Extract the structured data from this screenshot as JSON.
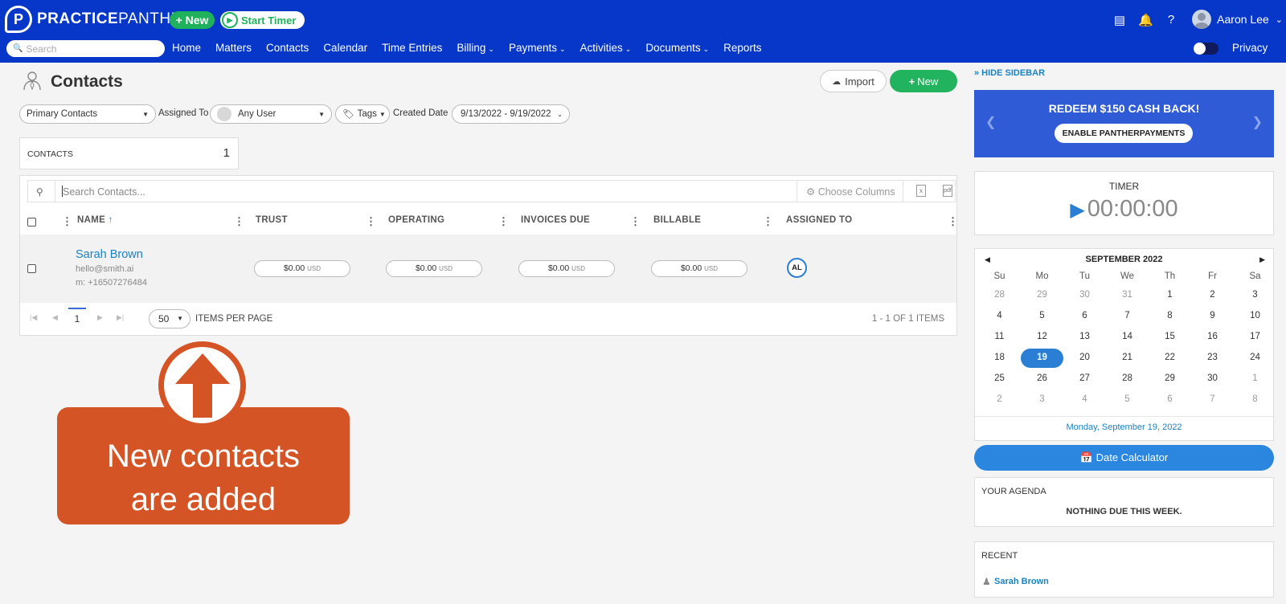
{
  "header": {
    "logo_bold": "PRACTICE",
    "logo_light": "PANTHER",
    "logo_reg": "®",
    "new_label": "+ New",
    "timer_label": "Start Timer",
    "user_name": "Aaron Lee",
    "search_placeholder": "Search",
    "privacy_label": "Privacy",
    "nav": [
      {
        "label": "Home",
        "dropdown": false
      },
      {
        "label": "Matters",
        "dropdown": false
      },
      {
        "label": "Contacts",
        "dropdown": false
      },
      {
        "label": "Calendar",
        "dropdown": false
      },
      {
        "label": "Time Entries",
        "dropdown": false
      },
      {
        "label": "Billing",
        "dropdown": true
      },
      {
        "label": "Payments",
        "dropdown": true
      },
      {
        "label": "Activities",
        "dropdown": true
      },
      {
        "label": "Documents",
        "dropdown": true
      },
      {
        "label": "Reports",
        "dropdown": false
      }
    ]
  },
  "page": {
    "title": "Contacts",
    "import_label": "Import",
    "new_label": "New"
  },
  "filters": {
    "contact_type": "Primary Contacts",
    "assigned_to_label": "Assigned To",
    "assigned_to_value": "Any User",
    "tags_label": "Tags",
    "created_date_label": "Created Date",
    "created_date_value": "9/13/2022 - 9/19/2022"
  },
  "count": {
    "label": "CONTACTS",
    "value": "1"
  },
  "grid": {
    "search_placeholder": "Search Contacts...",
    "choose_columns": "Choose Columns",
    "columns": [
      "NAME",
      "TRUST",
      "OPERATING",
      "INVOICES DUE",
      "BILLABLE",
      "ASSIGNED TO"
    ],
    "rows": [
      {
        "name": "Sarah Brown",
        "email": "hello@smith.ai",
        "phone": "m: +16507276484",
        "trust": "$0.00",
        "operating": "$0.00",
        "invoices_due": "$0.00",
        "billable": "$0.00",
        "currency": "USD",
        "assigned": "AL"
      }
    ],
    "pager": {
      "current_page": "1",
      "per_page": "50",
      "per_page_label": "ITEMS PER PAGE",
      "range": "1 - 1 OF 1 ITEMS"
    }
  },
  "callout": {
    "line1": "New contacts",
    "line2": "are added"
  },
  "sidebar": {
    "hide_label": "» HIDE SIDEBAR",
    "promo_title": "REDEEM $150 CASH BACK!",
    "promo_button": "ENABLE PANTHERPAYMENTS",
    "timer_title": "TIMER",
    "timer_value": "00:00:00",
    "calendar": {
      "month": "SEPTEMBER 2022",
      "dow": [
        "Su",
        "Mo",
        "Tu",
        "We",
        "Th",
        "Fr",
        "Sa"
      ],
      "weeks": [
        [
          "28",
          "29",
          "30",
          "31",
          "1",
          "2",
          "3"
        ],
        [
          "4",
          "5",
          "6",
          "7",
          "8",
          "9",
          "10"
        ],
        [
          "11",
          "12",
          "13",
          "14",
          "15",
          "16",
          "17"
        ],
        [
          "18",
          "19",
          "20",
          "21",
          "22",
          "23",
          "24"
        ],
        [
          "25",
          "26",
          "27",
          "28",
          "29",
          "30",
          "1"
        ],
        [
          "2",
          "3",
          "4",
          "5",
          "6",
          "7",
          "8"
        ]
      ],
      "selected_day": "19",
      "footer": "Monday, September 19, 2022"
    },
    "date_calculator": "Date Calculator",
    "agenda_title": "YOUR AGENDA",
    "agenda_empty": "NOTHING DUE THIS WEEK.",
    "recent_title": "RECENT",
    "recent_item": "Sarah Brown"
  },
  "colors": {
    "header_bg": "#0637c9",
    "accent_green": "#21b35e",
    "link_blue": "#1a82c4",
    "callout_orange": "#d55426",
    "calendar_blue": "#2a7fd4"
  }
}
